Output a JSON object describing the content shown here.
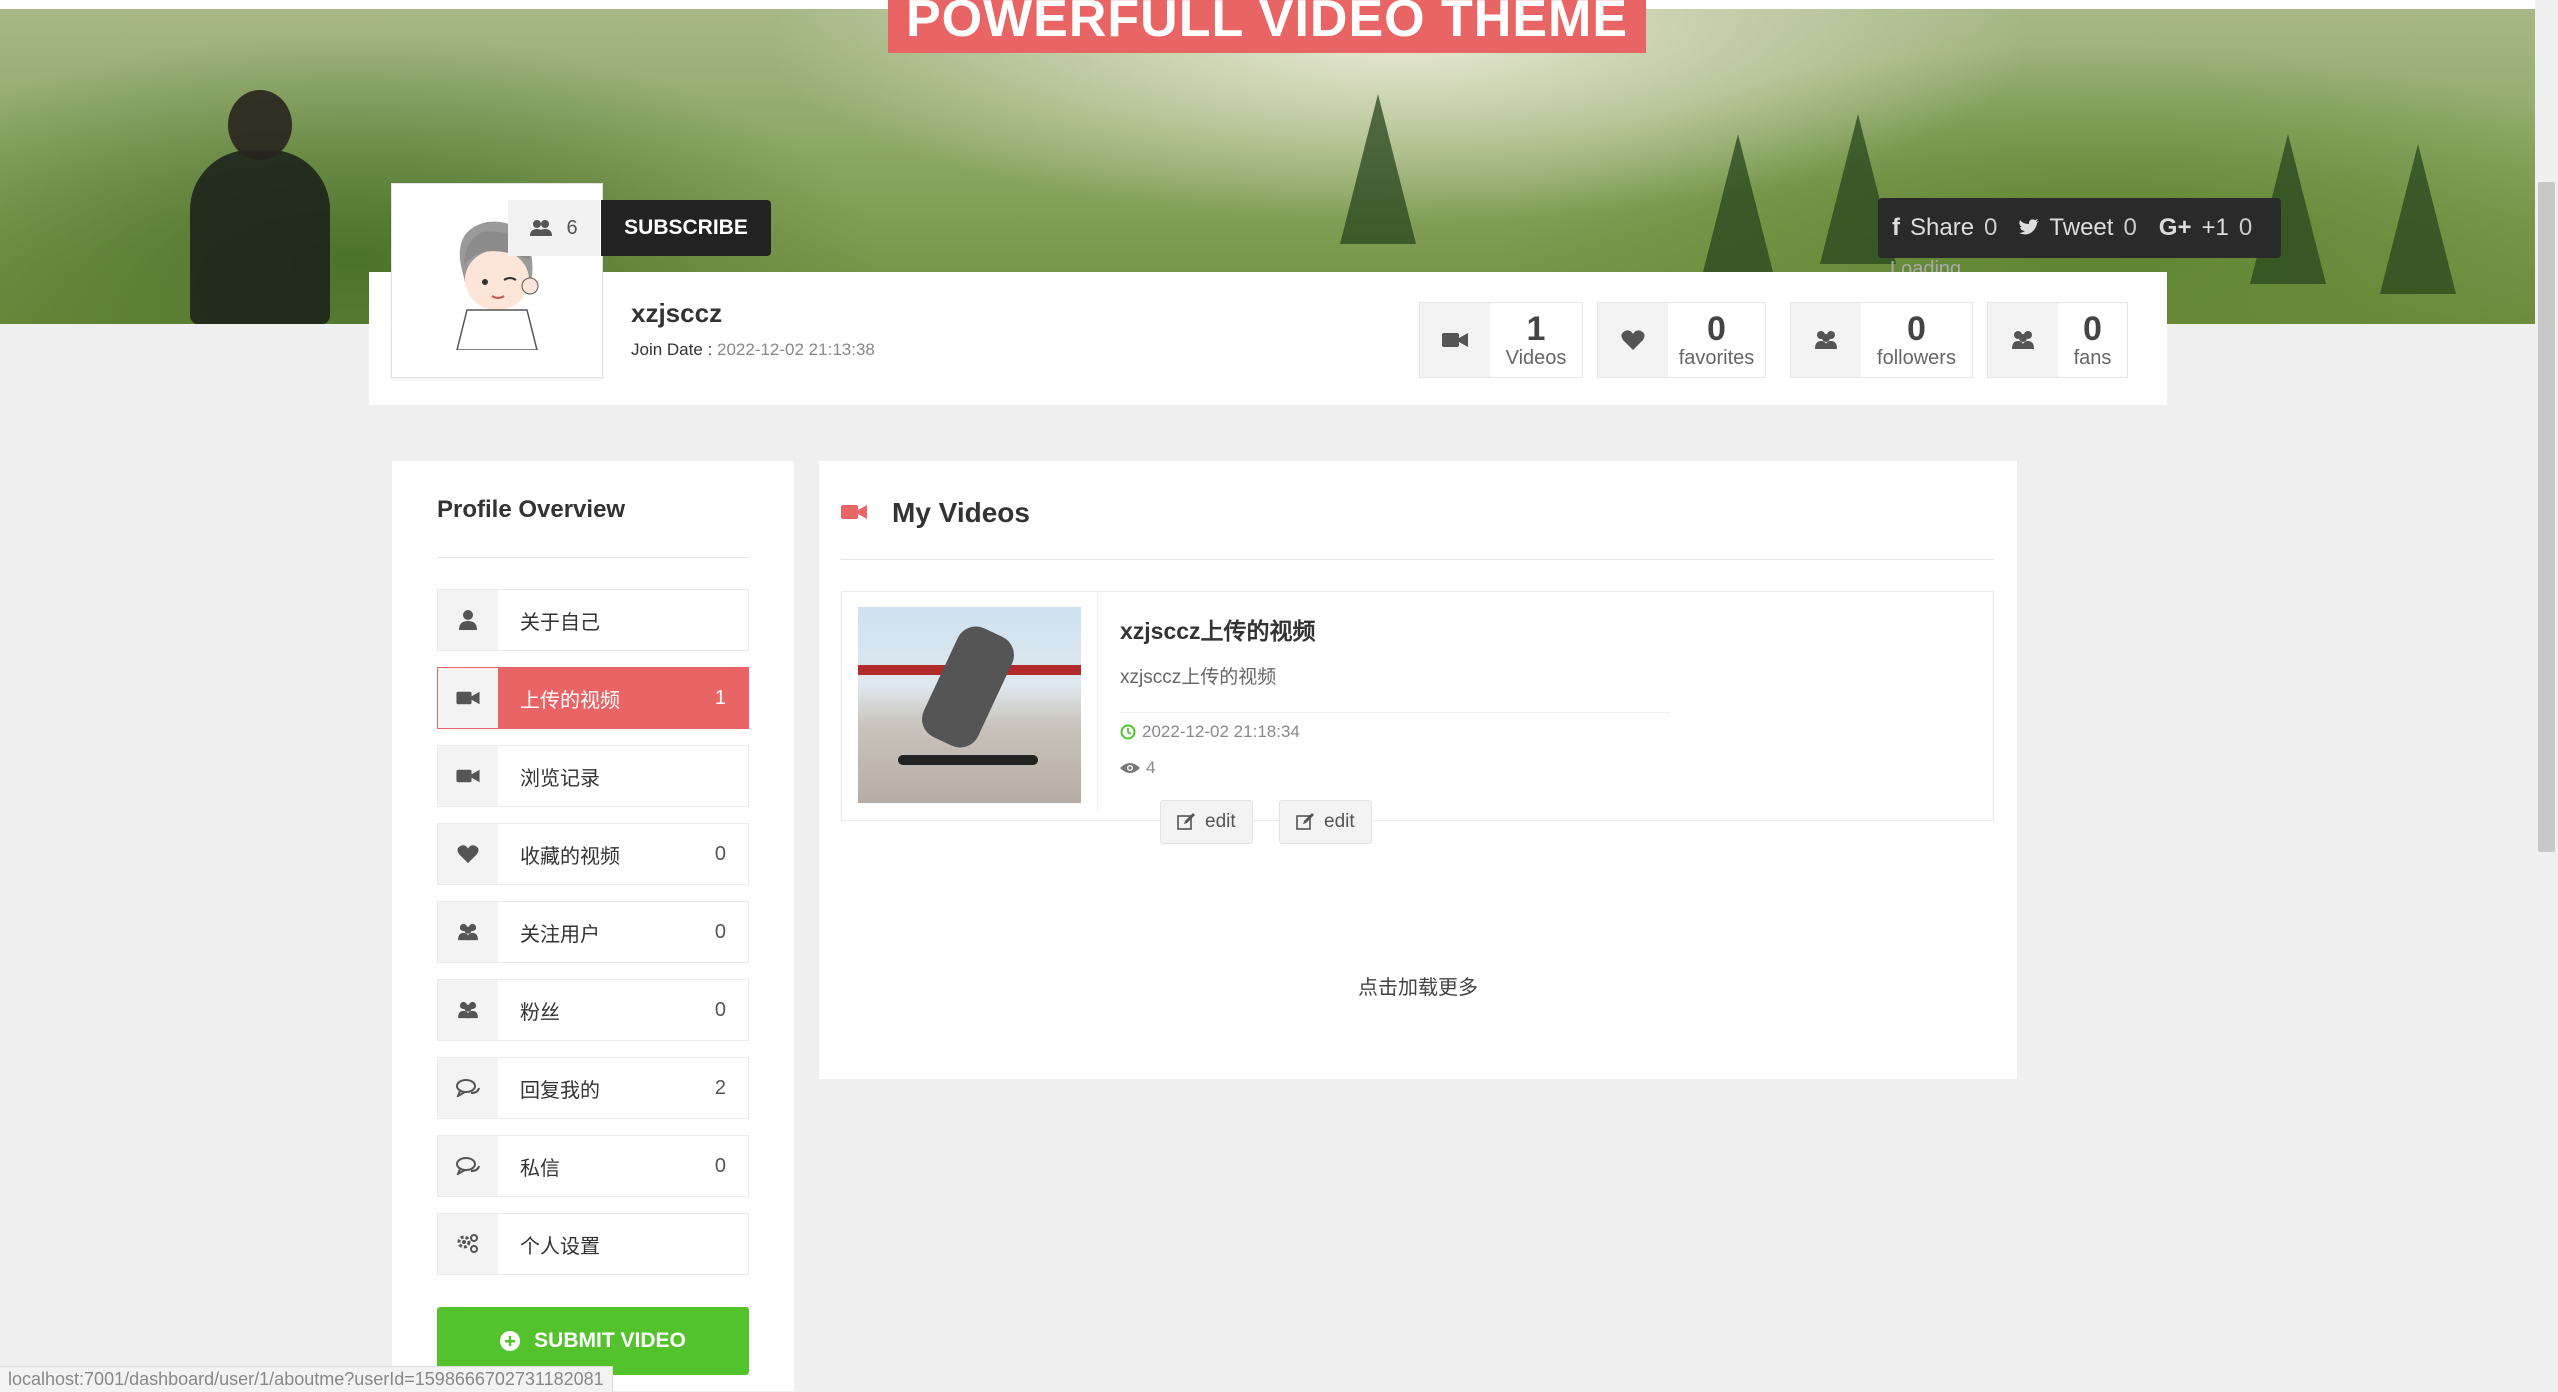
{
  "banner": {
    "title": "POWERFULL VIDEO THEME"
  },
  "profile": {
    "subscribers": "6",
    "subscribe_label": "SUBSCRIBE",
    "username": "xzjsccz",
    "join_label": "Join Date :",
    "join_date": "2022-12-02 21:13:38"
  },
  "social": {
    "share_label": "Share",
    "share_count": "0",
    "tweet_label": "Tweet",
    "tweet_count": "0",
    "gplus_label": "+1",
    "gplus_count": "0",
    "loading": "Loading..."
  },
  "stats": [
    {
      "num": "1",
      "label": "Videos",
      "icon": "video-camera-icon"
    },
    {
      "num": "0",
      "label": "favorites",
      "icon": "heart-icon"
    },
    {
      "num": "0",
      "label": "followers",
      "icon": "users-icon"
    },
    {
      "num": "0",
      "label": "fans",
      "icon": "users-icon"
    }
  ],
  "sidebar": {
    "title": "Profile Overview",
    "items": [
      {
        "label": "关于自己",
        "count": "",
        "icon": "user-icon"
      },
      {
        "label": "上传的视频",
        "count": "1",
        "icon": "video-camera-icon",
        "active": true
      },
      {
        "label": "浏览记录",
        "count": "",
        "icon": "video-camera-icon"
      },
      {
        "label": "收藏的视频",
        "count": "0",
        "icon": "heart-icon"
      },
      {
        "label": "关注用户",
        "count": "0",
        "icon": "users-icon"
      },
      {
        "label": "粉丝",
        "count": "0",
        "icon": "users-icon"
      },
      {
        "label": "回复我的",
        "count": "2",
        "icon": "comments-icon"
      },
      {
        "label": "私信",
        "count": "0",
        "icon": "comments-icon"
      },
      {
        "label": "个人设置",
        "count": "",
        "icon": "gears-icon"
      }
    ],
    "submit_label": "SUBMIT VIDEO"
  },
  "main": {
    "title": "My Videos",
    "videos": [
      {
        "title": "xzjsccz上传的视频",
        "description": "xzjsccz上传的视频",
        "date": "2022-12-02 21:18:34",
        "views": "4",
        "edit_label_1": "edit",
        "edit_label_2": "edit"
      }
    ],
    "load_more": "点击加载更多"
  },
  "status_bar": {
    "url": "localhost:7001/dashboard/user/1/aboutme?userId=1598666702731182081"
  },
  "colors": {
    "accent": "#e96464",
    "submit": "#53c22d",
    "dark": "#222222"
  }
}
